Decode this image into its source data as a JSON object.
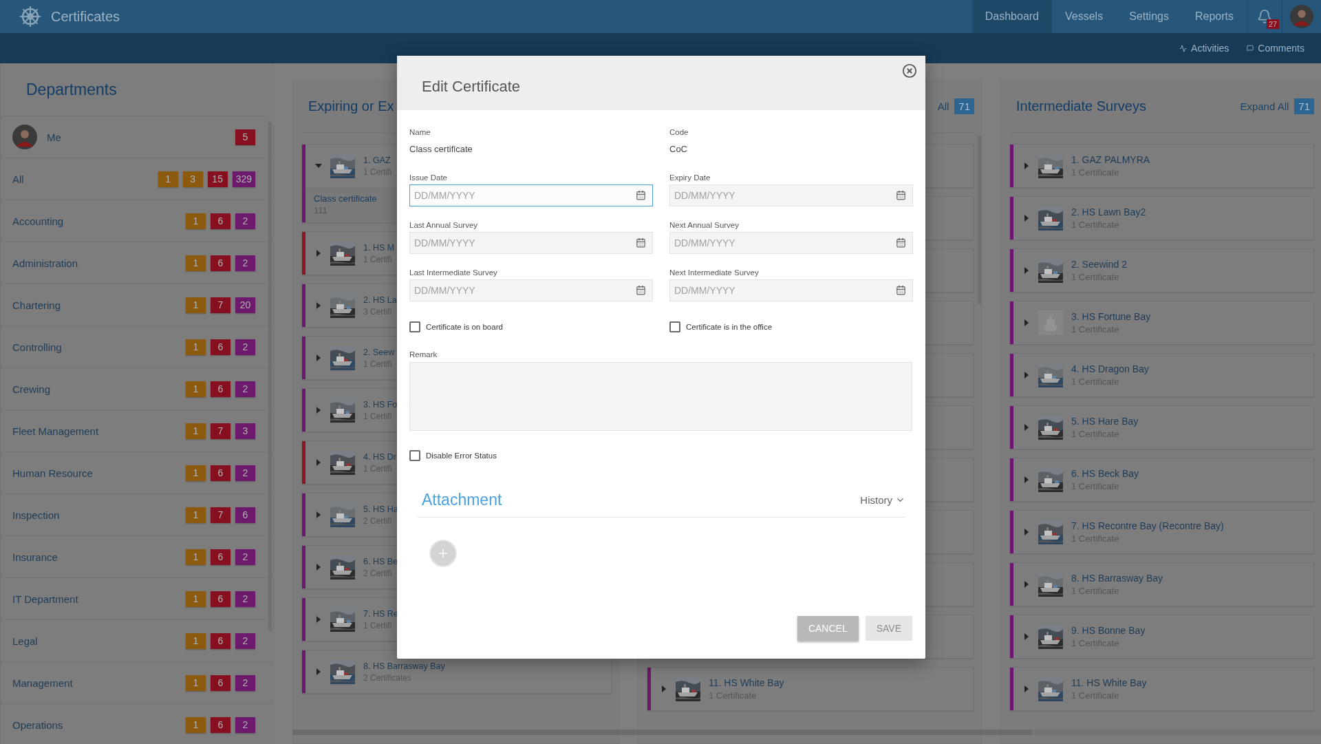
{
  "header": {
    "app_title": "Certificates",
    "nav": [
      {
        "label": "Dashboard",
        "selected": true
      },
      {
        "label": "Vessels",
        "selected": false
      },
      {
        "label": "Settings",
        "selected": false
      },
      {
        "label": "Reports",
        "selected": false
      }
    ],
    "notifications": "27"
  },
  "subbar": {
    "links": [
      {
        "label": "Activities",
        "kind": "activity"
      },
      {
        "label": "Comments",
        "kind": "comment"
      }
    ]
  },
  "departments": {
    "title": "Departments",
    "items": [
      {
        "name": "Me",
        "kind": "user",
        "badges": [
          {
            "value": "5",
            "color": "#86101f"
          }
        ]
      },
      {
        "name": "All",
        "kind": "group",
        "badges": [
          {
            "value": "1",
            "color": "#8c5a0e"
          },
          {
            "value": "3",
            "color": "#8c5a0e"
          },
          {
            "value": "15",
            "color": "#86101f"
          },
          {
            "value": "329",
            "color": "#6d1a6c"
          }
        ]
      },
      {
        "name": "Accounting",
        "kind": "group",
        "badges": [
          {
            "value": "1",
            "color": "#8c5a0e"
          },
          {
            "value": "6",
            "color": "#86101f"
          },
          {
            "value": "2",
            "color": "#6d1a6c"
          }
        ]
      },
      {
        "name": "Administration",
        "kind": "group",
        "badges": [
          {
            "value": "1",
            "color": "#8c5a0e"
          },
          {
            "value": "6",
            "color": "#86101f"
          },
          {
            "value": "2",
            "color": "#6d1a6c"
          }
        ]
      },
      {
        "name": "Chartering",
        "kind": "group",
        "badges": [
          {
            "value": "1",
            "color": "#8c5a0e"
          },
          {
            "value": "7",
            "color": "#86101f"
          },
          {
            "value": "20",
            "color": "#6d1a6c"
          }
        ]
      },
      {
        "name": "Controlling",
        "kind": "group",
        "badges": [
          {
            "value": "1",
            "color": "#8c5a0e"
          },
          {
            "value": "6",
            "color": "#86101f"
          },
          {
            "value": "2",
            "color": "#6d1a6c"
          }
        ]
      },
      {
        "name": "Crewing",
        "kind": "group",
        "badges": [
          {
            "value": "1",
            "color": "#8c5a0e"
          },
          {
            "value": "6",
            "color": "#86101f"
          },
          {
            "value": "2",
            "color": "#6d1a6c"
          }
        ]
      },
      {
        "name": "Fleet Management",
        "kind": "group",
        "badges": [
          {
            "value": "1",
            "color": "#8c5a0e"
          },
          {
            "value": "7",
            "color": "#86101f"
          },
          {
            "value": "3",
            "color": "#6d1a6c"
          }
        ]
      },
      {
        "name": "Human Resource",
        "kind": "group",
        "badges": [
          {
            "value": "1",
            "color": "#8c5a0e"
          },
          {
            "value": "6",
            "color": "#86101f"
          },
          {
            "value": "2",
            "color": "#6d1a6c"
          }
        ]
      },
      {
        "name": "Inspection",
        "kind": "group",
        "badges": [
          {
            "value": "1",
            "color": "#8c5a0e"
          },
          {
            "value": "7",
            "color": "#86101f"
          },
          {
            "value": "6",
            "color": "#6d1a6c"
          }
        ]
      },
      {
        "name": "Insurance",
        "kind": "group",
        "badges": [
          {
            "value": "1",
            "color": "#8c5a0e"
          },
          {
            "value": "6",
            "color": "#86101f"
          },
          {
            "value": "2",
            "color": "#6d1a6c"
          }
        ]
      },
      {
        "name": "IT Department",
        "kind": "group",
        "badges": [
          {
            "value": "1",
            "color": "#8c5a0e"
          },
          {
            "value": "6",
            "color": "#86101f"
          },
          {
            "value": "2",
            "color": "#6d1a6c"
          }
        ]
      },
      {
        "name": "Legal",
        "kind": "group",
        "badges": [
          {
            "value": "1",
            "color": "#8c5a0e"
          },
          {
            "value": "6",
            "color": "#86101f"
          },
          {
            "value": "2",
            "color": "#6d1a6c"
          }
        ]
      },
      {
        "name": "Management",
        "kind": "group",
        "badges": [
          {
            "value": "1",
            "color": "#8c5a0e"
          },
          {
            "value": "6",
            "color": "#86101f"
          },
          {
            "value": "2",
            "color": "#6d1a6c"
          }
        ]
      },
      {
        "name": "Operations",
        "kind": "group",
        "badges": [
          {
            "value": "1",
            "color": "#8c5a0e"
          },
          {
            "value": "6",
            "color": "#86101f"
          },
          {
            "value": "2",
            "color": "#6d1a6c"
          }
        ]
      }
    ]
  },
  "columns": [
    {
      "title": "Expiring or Ex",
      "cards": [
        {
          "kind": "vessel",
          "title": "1. GAZ",
          "subtitle": "1 Certifi",
          "color": "#6e1670",
          "expanded": true,
          "photo": true,
          "details": [
            {
              "name": "Class certificate",
              "value": "111"
            }
          ]
        },
        {
          "kind": "vessel",
          "title": "1. HS M",
          "subtitle": "1 Certifi",
          "color": "#8a1524",
          "expanded": false,
          "photo": true
        },
        {
          "kind": "vessel",
          "title": "2. HS La",
          "subtitle": "3 Certifi",
          "color": "#6e1670",
          "expanded": false,
          "photo": true
        },
        {
          "kind": "vessel",
          "title": "2. Seew",
          "subtitle": "1 Certifi",
          "color": "#6e1670",
          "expanded": false,
          "photo": true
        },
        {
          "kind": "vessel",
          "title": "3. HS Fo",
          "subtitle": "1 Certifi",
          "color": "#6e1670",
          "expanded": false,
          "photo": true
        },
        {
          "kind": "vessel",
          "title": "4. HS Dr",
          "subtitle": "1 Certifi",
          "color": "#8a1524",
          "expanded": false,
          "photo": true
        },
        {
          "kind": "vessel",
          "title": "5. HS Ha",
          "subtitle": "2 Certifi",
          "color": "#6e1670",
          "expanded": false,
          "photo": true
        },
        {
          "kind": "vessel",
          "title": "6. HS Be",
          "subtitle": "2 Certifi",
          "color": "#6e1670",
          "expanded": false,
          "photo": true
        },
        {
          "kind": "vessel",
          "title": "7. HS Re",
          "subtitle": "1 Certifi",
          "color": "#6e1670",
          "expanded": false,
          "photo": true
        },
        {
          "kind": "vessel",
          "title": "8. HS Barrasway Bay",
          "subtitle": "2 Certificates",
          "color": "#6e1670",
          "expanded": false,
          "photo": true
        }
      ]
    },
    {
      "expand_label": "All",
      "count": "71",
      "cards": [
        {
          "kind": "blank"
        },
        {
          "kind": "blank"
        },
        {
          "kind": "blank"
        },
        {
          "kind": "blank"
        },
        {
          "kind": "blank"
        },
        {
          "kind": "blank"
        },
        {
          "kind": "blank"
        },
        {
          "kind": "blank"
        },
        {
          "kind": "blank"
        },
        {
          "kind": "blank"
        },
        {
          "kind": "vessel",
          "title": "11. HS White Bay",
          "subtitle": "1 Certificate",
          "color": "#6e1670",
          "expanded": false,
          "photo": true
        }
      ]
    },
    {
      "title": "Intermediate Surveys",
      "expand_label": "Expand All",
      "count": "71",
      "cards": [
        {
          "kind": "vessel",
          "title": "1. GAZ PALMYRA",
          "subtitle": "1 Certificate",
          "color": "#6e1670",
          "expanded": false,
          "photo": true
        },
        {
          "kind": "vessel",
          "title": "2. HS Lawn Bay2",
          "subtitle": "1 Certificate",
          "color": "#6e1670",
          "expanded": false,
          "photo": true
        },
        {
          "kind": "vessel",
          "title": "2. Seewind 2",
          "subtitle": "1 Certificate",
          "color": "#6e1670",
          "expanded": false,
          "photo": true
        },
        {
          "kind": "vessel",
          "title": "3. HS Fortune Bay",
          "subtitle": "1 Certificate",
          "color": "#6e1670",
          "expanded": false,
          "photo": false
        },
        {
          "kind": "vessel",
          "title": "4. HS Dragon Bay",
          "subtitle": "1 Certificate",
          "color": "#6e1670",
          "expanded": false,
          "photo": true
        },
        {
          "kind": "vessel",
          "title": "5. HS Hare Bay",
          "subtitle": "1 Certificate",
          "color": "#6e1670",
          "expanded": false,
          "photo": true
        },
        {
          "kind": "vessel",
          "title": "6. HS Beck Bay",
          "subtitle": "1 Certificate",
          "color": "#6e1670",
          "expanded": false,
          "photo": true
        },
        {
          "kind": "vessel",
          "title": "7. HS Recontre Bay (Recontre Bay)",
          "subtitle": "1 Certificate",
          "color": "#6e1670",
          "expanded": false,
          "photo": true
        },
        {
          "kind": "vessel",
          "title": "8. HS Barrasway Bay",
          "subtitle": "1 Certificate",
          "color": "#6e1670",
          "expanded": false,
          "photo": true
        },
        {
          "kind": "vessel",
          "title": "9. HS Bonne Bay",
          "subtitle": "1 Certificate",
          "color": "#6e1670",
          "expanded": false,
          "photo": true
        },
        {
          "kind": "vessel",
          "title": "11. HS White Bay",
          "subtitle": "1 Certificate",
          "color": "#6e1670",
          "expanded": false,
          "photo": true
        }
      ]
    }
  ],
  "dialog": {
    "title": "Edit Certificate",
    "info": [
      {
        "label": "Name",
        "value": "Class certificate"
      },
      {
        "label": "Code",
        "value": "CoC"
      }
    ],
    "date_fields": [
      {
        "label": "Issue Date",
        "placeholder": "DD/MM/YYYY",
        "focused": true
      },
      {
        "label": "Expiry Date",
        "placeholder": "DD/MM/YYYY",
        "focused": false
      },
      {
        "label": "Last Annual Survey",
        "placeholder": "DD/MM/YYYY",
        "focused": false
      },
      {
        "label": "Next Annual Survey",
        "placeholder": "DD/MM/YYYY",
        "focused": false
      },
      {
        "label": "Last Intermediate Survey",
        "placeholder": "DD/MM/YYYY",
        "focused": false
      },
      {
        "label": "Next Intermediate Survey",
        "placeholder": "DD/MM/YYYY",
        "focused": false
      }
    ],
    "checkboxes": [
      {
        "label": "Certificate is on board",
        "checked": false
      },
      {
        "label": "Certificate is in the office",
        "checked": false
      }
    ],
    "remark": {
      "label": "Remark"
    },
    "disable_error": {
      "label": "Disable Error Status",
      "checked": false
    },
    "attachment": {
      "title": "Attachment",
      "history_label": "History"
    },
    "buttons": [
      {
        "label": "CANCEL",
        "kind": "cancel",
        "disabled": false
      },
      {
        "label": "SAVE",
        "kind": "save",
        "disabled": true
      }
    ]
  }
}
